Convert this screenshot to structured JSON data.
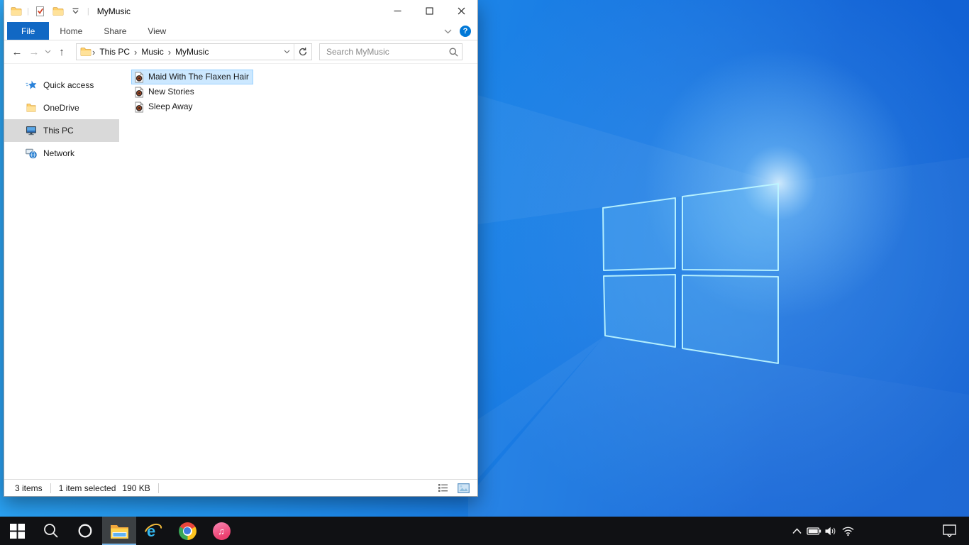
{
  "explorer": {
    "title": "MyMusic",
    "titlebar": {
      "qat_icons": [
        "folder",
        "properties-check",
        "new-folder",
        "customize-dropdown"
      ],
      "window_controls": [
        "minimize",
        "maximize",
        "close"
      ]
    },
    "ribbon": {
      "tabs": [
        {
          "label": "File",
          "active": true
        },
        {
          "label": "Home",
          "active": false
        },
        {
          "label": "Share",
          "active": false
        },
        {
          "label": "View",
          "active": false
        }
      ],
      "help_glyph": "?"
    },
    "navigation": {
      "back_glyph": "←",
      "forward_glyph": "→",
      "up_glyph": "↑",
      "breadcrumb": [
        "This PC",
        "Music",
        "MyMusic"
      ],
      "breadcrumb_separator": "›",
      "search_placeholder": "Search MyMusic"
    },
    "sidebar": {
      "items": [
        {
          "label": "Quick access",
          "icon": "quick-access-star",
          "selected": false
        },
        {
          "label": "OneDrive",
          "icon": "onedrive-folder",
          "selected": false
        },
        {
          "label": "This PC",
          "icon": "this-pc-monitor",
          "selected": true
        },
        {
          "label": "Network",
          "icon": "network-globe",
          "selected": false
        }
      ]
    },
    "files": {
      "items": [
        {
          "name": "Maid With The Flaxen Hair",
          "icon": "music-file",
          "selected": true
        },
        {
          "name": "New Stories",
          "icon": "music-file",
          "selected": false
        },
        {
          "name": "Sleep Away",
          "icon": "music-file",
          "selected": false
        }
      ]
    },
    "status_bar": {
      "item_count": "3 items",
      "selection_count": "1 item selected",
      "selection_size": "190 KB",
      "view_buttons": [
        "details-view",
        "large-icons-view"
      ],
      "active_view": "large-icons-view"
    }
  },
  "taskbar": {
    "buttons": [
      {
        "name": "start",
        "icon": "windows-logo",
        "active": false
      },
      {
        "name": "search",
        "icon": "magnifier",
        "active": false
      },
      {
        "name": "cortana",
        "icon": "circle-ring",
        "active": false
      },
      {
        "name": "file-explorer",
        "icon": "explorer-folder",
        "active": true
      },
      {
        "name": "internet-explorer",
        "icon": "ie-e",
        "active": false
      },
      {
        "name": "chrome",
        "icon": "chrome-ball",
        "active": false
      },
      {
        "name": "itunes",
        "icon": "itunes-note",
        "active": false
      }
    ],
    "ie_letter": "e",
    "itunes_note_glyph": "♫",
    "tray_icons": [
      "chevron-up",
      "battery",
      "volume",
      "wifi"
    ],
    "action_center_icon": "action-center"
  },
  "colors": {
    "file_tab_blue": "#1168c4",
    "help_blue": "#0078d7",
    "selection_fill": "#cce8ff",
    "selection_border": "#99d1ff",
    "sidebar_selected": "#d9d9d9",
    "taskbar_bg": "#101114",
    "taskbar_active_bg": "#3c4043",
    "taskbar_active_underline": "#7cb8e8",
    "wallpaper_left": "#2ea7f5",
    "wallpaper_right": "#1160d2"
  }
}
